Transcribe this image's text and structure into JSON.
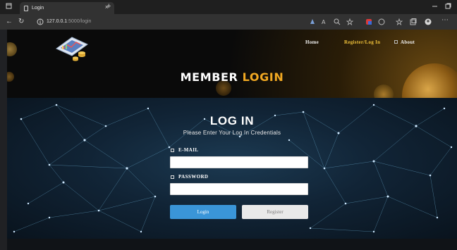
{
  "browser": {
    "tab_title": "Login",
    "tab_close": "×",
    "new_tab": "+",
    "url_host": "127.0.0.1",
    "url_rest": ":5000/login"
  },
  "header": {
    "nav": {
      "home": "Home",
      "register_login": "Register/Log In",
      "about": "About"
    },
    "title_word1": "MEMBER",
    "title_word2": "LOGIN"
  },
  "login": {
    "heading": "LOG IN",
    "subtitle": "Please Enter Your Log In Credentials",
    "email_label": "E-MAIL",
    "email_value": "",
    "password_label": "PASSWORD",
    "password_value": "",
    "login_button": "Login",
    "register_button": "Register"
  },
  "colors": {
    "accent_gold": "#f2a922",
    "login_button": "#3a95d8",
    "register_button": "#e9e9e9"
  }
}
